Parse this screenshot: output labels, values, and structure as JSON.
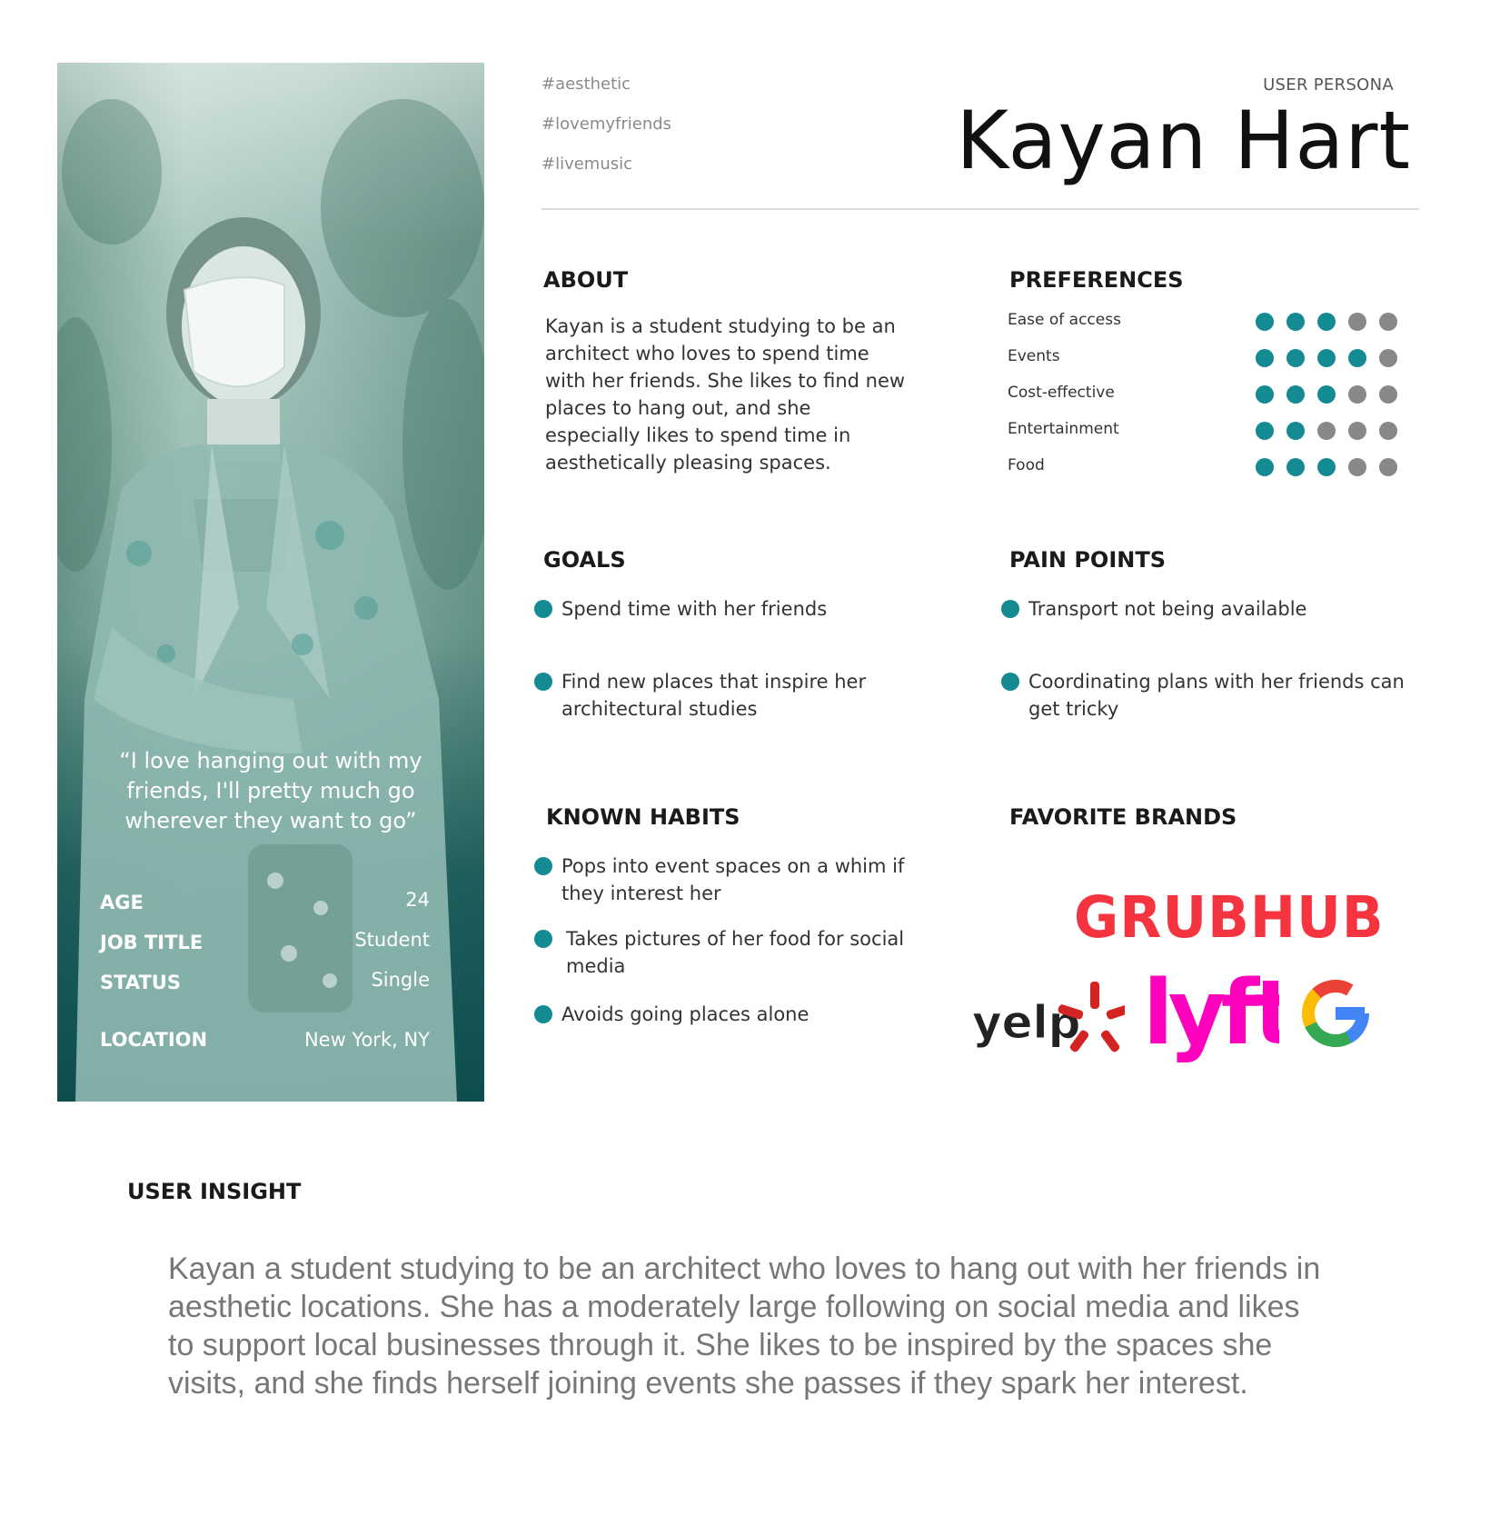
{
  "hashtags": [
    "#aesthetic",
    "#lovemyfriends",
    "#livemusic"
  ],
  "persona": {
    "label": "USER PERSONA",
    "name": "Kayan Hart"
  },
  "card": {
    "quote": "“I love hanging out with my friends, I'll pretty much go wherever they want to go”",
    "stats": [
      {
        "label": "AGE",
        "value": "24"
      },
      {
        "label": "JOB TITLE",
        "value": "Student"
      },
      {
        "label": "STATUS",
        "value": "Single"
      },
      {
        "label": "LOCATION",
        "value": "New York, NY"
      }
    ]
  },
  "about": {
    "title": "ABOUT",
    "text": "Kayan is a student studying to be an architect who loves to spend time with her friends. She likes to find new places to hang out, and she especially likes to spend time in aesthetically pleasing spaces."
  },
  "preferences": {
    "title": "PREFERENCES",
    "max": 5,
    "items": [
      {
        "label": "Ease of access",
        "rating": 3
      },
      {
        "label": "Events",
        "rating": 4
      },
      {
        "label": "Cost-effective",
        "rating": 3
      },
      {
        "label": "Entertainment",
        "rating": 2
      },
      {
        "label": "Food",
        "rating": 3
      }
    ]
  },
  "goals": {
    "title": "GOALS",
    "items": [
      "Spend time with her friends",
      "Find new places that inspire her architectural studies"
    ]
  },
  "pain_points": {
    "title": "PAIN POINTS",
    "items": [
      "Transport not being available",
      "Coordinating plans with her friends can get tricky"
    ]
  },
  "habits": {
    "title": "KNOWN HABITS",
    "items": [
      "Pops into event spaces on a whim if they interest her",
      "Takes pictures of her food for social media",
      "Avoids going places alone"
    ]
  },
  "brands": {
    "title": "FAVORITE BRANDS",
    "grubhub": "GRUBHUB",
    "yelp": "yelp",
    "lyft": "lyft",
    "google": "G",
    "colors": {
      "grubhub": "#f63440",
      "yelp": "#d32323",
      "lyft": "#ff00bf"
    }
  },
  "insight": {
    "title": "USER INSIGHT",
    "text": "Kayan a student studying to be an architect who loves to hang out with her friends in aesthetic locations. She has a moderately large following on social media and likes to support local businesses through it. She likes to be inspired by the spaces she visits, and she finds herself joining events she passes if they spark her interest."
  },
  "colors": {
    "accent": "#148a92",
    "inactive": "#888888",
    "card_dark": "#0e4d4e"
  }
}
